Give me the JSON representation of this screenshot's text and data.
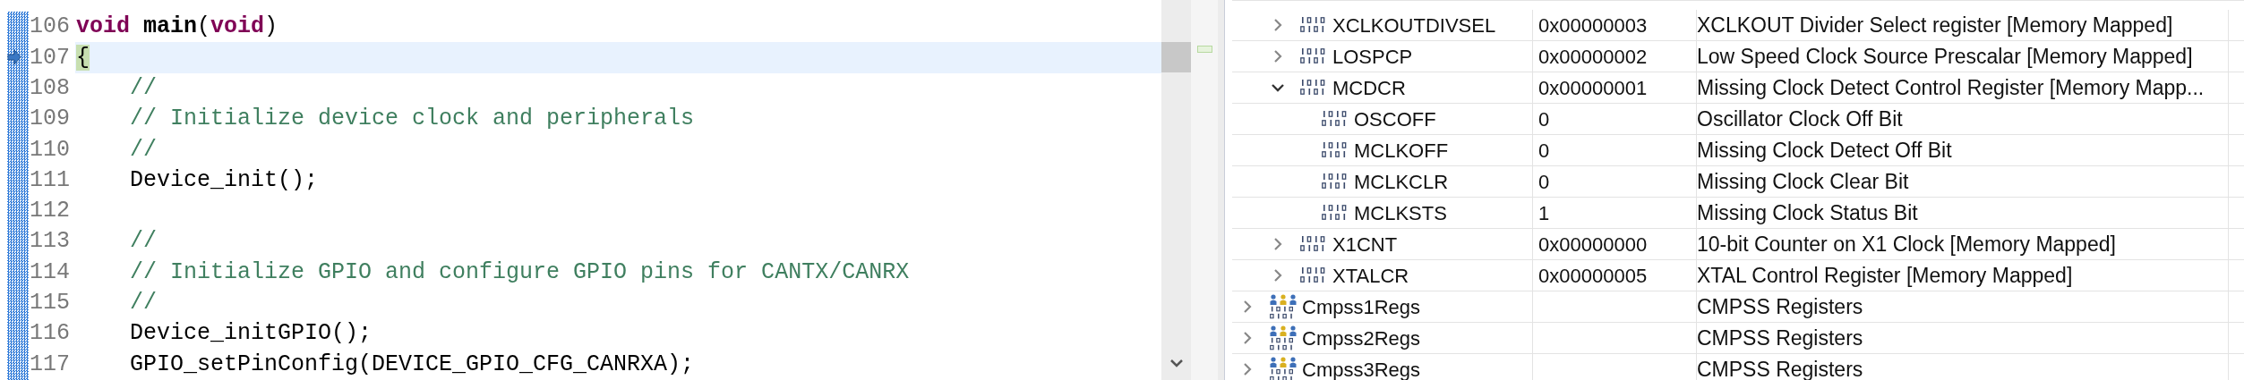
{
  "editor": {
    "lines": [
      {
        "number": "106",
        "current": false,
        "tokens": [
          {
            "kind": "keyword",
            "text": "void"
          },
          {
            "kind": "bold",
            "text": " main"
          },
          {
            "kind": "plain",
            "text": "("
          },
          {
            "kind": "keyword",
            "text": "void"
          },
          {
            "kind": "plain",
            "text": ")"
          }
        ]
      },
      {
        "number": "107",
        "current": true,
        "tokens": [
          {
            "kind": "match",
            "text": "{"
          }
        ]
      },
      {
        "number": "108",
        "current": false,
        "tokens": [
          {
            "kind": "comment",
            "text": "    //"
          }
        ]
      },
      {
        "number": "109",
        "current": false,
        "tokens": [
          {
            "kind": "comment",
            "text": "    // Initialize device clock and peripherals"
          }
        ]
      },
      {
        "number": "110",
        "current": false,
        "tokens": [
          {
            "kind": "comment",
            "text": "    //"
          }
        ]
      },
      {
        "number": "111",
        "current": false,
        "tokens": [
          {
            "kind": "plain",
            "text": "    Device_init();"
          }
        ]
      },
      {
        "number": "112",
        "current": false
      },
      {
        "number": "113",
        "current": false,
        "tokens": [
          {
            "kind": "comment",
            "text": "    //"
          }
        ]
      },
      {
        "number": "114",
        "current": false,
        "tokens": [
          {
            "kind": "comment",
            "text": "    // Initialize GPIO and configure GPIO pins for CANTX/CANRX"
          }
        ]
      },
      {
        "number": "115",
        "current": false,
        "tokens": [
          {
            "kind": "comment",
            "text": "    //"
          }
        ]
      },
      {
        "number": "116",
        "current": false,
        "tokens": [
          {
            "kind": "plain",
            "text": "    Device_initGPIO();"
          }
        ]
      },
      {
        "number": "117",
        "current": false,
        "tokens": [
          {
            "kind": "plain",
            "text": "    GPIO_setPinConfig(DEVICE_GPIO_CFG_CANRXA);"
          }
        ]
      }
    ]
  },
  "registers": {
    "rows": [
      {
        "kind": "register",
        "name": "XCLKOUTDIVSEL",
        "value": "0x00000003",
        "description": "XCLKOUT Divider Select register [Memory Mapped]",
        "expanded": false
      },
      {
        "kind": "register",
        "name": "LOSPCP",
        "value": "0x00000002",
        "description": "Low Speed Clock Source Prescalar [Memory Mapped]",
        "expanded": false
      },
      {
        "kind": "register",
        "name": "MCDCR",
        "value": "0x00000001",
        "description": "Missing Clock Detect Control Register [Memory Mapp...",
        "expanded": true,
        "children": [
          {
            "kind": "field",
            "name": "OSCOFF",
            "value": "0",
            "description": "Oscillator Clock Off Bit"
          },
          {
            "kind": "field",
            "name": "MCLKOFF",
            "value": "0",
            "description": "Missing Clock Detect Off Bit"
          },
          {
            "kind": "field",
            "name": "MCLKCLR",
            "value": "0",
            "description": "Missing Clock Clear Bit"
          },
          {
            "kind": "field",
            "name": "MCLKSTS",
            "value": "1",
            "description": "Missing Clock Status Bit"
          }
        ]
      },
      {
        "kind": "register",
        "name": "X1CNT",
        "value": "0x00000000",
        "description": "10-bit Counter on X1 Clock [Memory Mapped]",
        "expanded": false
      },
      {
        "kind": "register",
        "name": "XTALCR",
        "value": "0x00000005",
        "description": "XTAL Control Register [Memory Mapped]",
        "expanded": false
      },
      {
        "kind": "group",
        "name": "Cmpss1Regs",
        "description": "CMPSS Registers",
        "expanded": false
      },
      {
        "kind": "group",
        "name": "Cmpss2Regs",
        "description": "CMPSS Registers",
        "expanded": false
      },
      {
        "kind": "group",
        "name": "Cmpss3Regs",
        "description": "CMPSS Registers",
        "expanded": false
      }
    ]
  }
}
